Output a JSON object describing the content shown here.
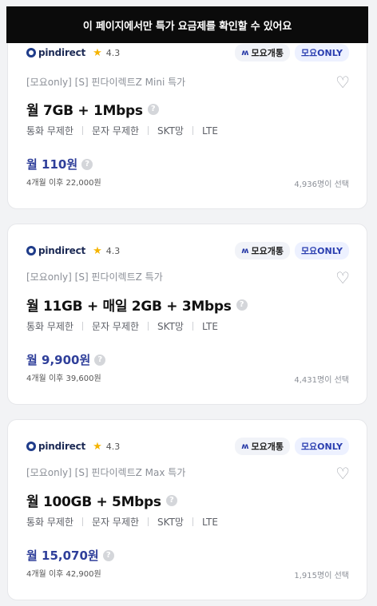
{
  "banner": {
    "text": "이 페이지에서만 특가 요금제를 확인할 수 있어요"
  },
  "icons": {
    "heart": "heart-outline-icon",
    "star": "star-icon",
    "help": "question-circle-icon",
    "brand": "pindirect-logo-icon",
    "moyo": "moyo-logo-icon"
  },
  "colors": {
    "banner_bg": "#0b0b0b",
    "price": "#2f3f9a",
    "star": "#f5b400",
    "badge_only_text": "#2b3fb0"
  },
  "plans": [
    {
      "brand": "pindirect",
      "rating": "4.3",
      "badge_moyo": "모요개통",
      "badge_only": "모요ONLY",
      "subtitle": "[모요only] [S] 핀다이렉트Z Mini 특가",
      "title": "월 7GB + 1Mbps",
      "features": [
        "통화 무제한",
        "문자 무제한",
        "SKT망",
        "LTE"
      ],
      "price": "월 110원",
      "after_price": "4개월 이후 22,000원",
      "selected": "4,936명이 선택"
    },
    {
      "brand": "pindirect",
      "rating": "4.3",
      "badge_moyo": "모요개통",
      "badge_only": "모요ONLY",
      "subtitle": "[모요only] [S] 핀다이렉트Z 특가",
      "title": "월 11GB + 매일 2GB + 3Mbps",
      "features": [
        "통화 무제한",
        "문자 무제한",
        "SKT망",
        "LTE"
      ],
      "price": "월 9,900원",
      "after_price": "4개월 이후 39,600원",
      "selected": "4,431명이 선택"
    },
    {
      "brand": "pindirect",
      "rating": "4.3",
      "badge_moyo": "모요개통",
      "badge_only": "모요ONLY",
      "subtitle": "[모요only] [S] 핀다이렉트Z Max 특가",
      "title": "월 100GB + 5Mbps",
      "features": [
        "통화 무제한",
        "문자 무제한",
        "SKT망",
        "LTE"
      ],
      "price": "월 15,070원",
      "after_price": "4개월 이후 42,900원",
      "selected": "1,915명이 선택"
    }
  ]
}
